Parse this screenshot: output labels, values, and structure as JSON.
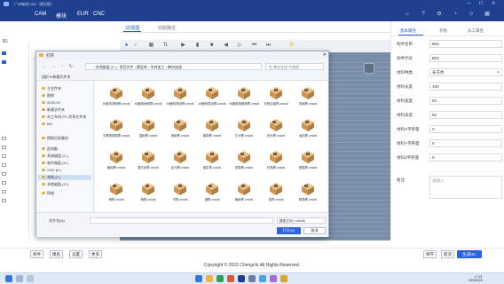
{
  "window": {
    "title": "广州城池CAM（测试版）"
  },
  "menubar": {
    "items": [
      "CAM",
      "模块",
      "EUR",
      "CNC"
    ]
  },
  "left": {
    "header": "B1"
  },
  "tabs": [
    {
      "label": "3D视图"
    },
    {
      "label": "切削路径"
    }
  ],
  "dialog": {
    "title": "打开",
    "address": "› 本地磁盘 (F:) › 项目文件 › 模型库 › 木材加工 › 榫卯连接",
    "search_placeholder": "在 榫卯连接 中搜索",
    "command_bar": "组织 ▾     新建文件夹",
    "sidebar": [
      {
        "label": "主文件夹",
        "sel": false
      },
      {
        "label": "图库",
        "sel": false
      },
      {
        "label": "2025-09",
        "sel": false
      },
      {
        "label": "新建文件夹",
        "sel": false
      },
      {
        "label": "木工车间-PC-共享文件夹",
        "sel": false
      },
      {
        "label": "Bin",
        "sel": false
      },
      {
        "label": "提取目录备份",
        "sel": false
      },
      {
        "label": "此电脑",
        "sel": false
      },
      {
        "label": "系统磁盘 (C:)",
        "sel": false
      },
      {
        "label": "软件磁盘 (D:)",
        "sel": false
      },
      {
        "label": "CNC (E:)",
        "sel": false
      },
      {
        "label": "本地 (F:)",
        "sel": true
      },
      {
        "label": "本地磁盘 (G:)",
        "sel": false
      },
      {
        "label": "网络",
        "sel": false
      }
    ],
    "files": [
      "45度内角斜榫.cmodl",
      "45度单面斜榫.cmodl",
      "45度斜角全榫.cmodl",
      "45度斜角出榫.cmodl",
      "45度斜角格角榫.cmodl",
      "长短对接榫.cmodl",
      "双肩榫.cmodl",
      "半贯穿燕尾榫.cmodl",
      "插肩榫.cmodl",
      "抱肩榫.cmodl",
      "格角榫.cmodl",
      "平头榫.cmodl",
      "夹头榫.cmodl",
      "龙凤榫.cmodl",
      "套肩榫.cmodl",
      "霸王枨榫.cmodl",
      "走马榫.cmodl",
      "楔钉榫.cmodl",
      "穿带榫.cmodl",
      "托角榫.cmodl",
      "燕尾榫.cmodl",
      "明榫.cmodl",
      "暗榫.cmodl",
      "半榫.cmodl",
      "通榫.cmodl",
      "格肩榫.cmodl",
      "挂榫.cmodl",
      "粽角榫.cmodl"
    ],
    "filename_label": "文件名(N):",
    "filetype": "模型文件(*.cmodl)",
    "open_label": "打开(O)",
    "cancel_label": "取消"
  },
  "right_panel": {
    "tabs": [
      "基本属性",
      "参数",
      "加工属性"
    ],
    "rows": [
      {
        "label": "构件名称",
        "value": "B01"
      },
      {
        "label": "构件代号",
        "value": "B01"
      },
      {
        "label": "材料种类",
        "value": "长方体"
      },
      {
        "label": "材料长度",
        "value": "100"
      },
      {
        "label": "材料宽度",
        "value": "50"
      },
      {
        "label": "材料高度",
        "value": "50"
      },
      {
        "label": "材料X平移量",
        "value": "0"
      },
      {
        "label": "材料Y平移量",
        "value": "0"
      },
      {
        "label": "材料Z平移量",
        "value": "0"
      },
      {
        "label": "备注",
        "value": ""
      }
    ],
    "remark_placeholder": "请输入"
  },
  "footer_buttons": [
    "构件",
    "模具",
    "设置",
    "更多"
  ],
  "action_buttons": {
    "save": "保存",
    "cancel": "取消",
    "output": "生成NC"
  },
  "copyright": "Copyright © 2022 Chengchi.All Rights Reserved.",
  "tray": {
    "time": "17:21",
    "date": "2025/9/29"
  },
  "colors": {
    "brand": "#1f3f8f",
    "accent": "#2e62d9",
    "canvas": "#7a8da8"
  }
}
